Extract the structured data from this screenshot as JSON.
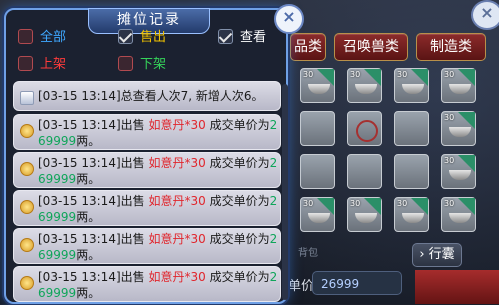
{
  "popup": {
    "title": "摊位记录",
    "filters": [
      {
        "label": "全部",
        "checked": false,
        "color": "#3fa8ff"
      },
      {
        "label": "售出",
        "checked": true,
        "color": "#f2c200"
      },
      {
        "label": "查看",
        "checked": true,
        "color": "#ffffff"
      },
      {
        "label": "上架",
        "checked": false,
        "color": "#ff3b3b"
      },
      {
        "label": "下架",
        "checked": false,
        "color": "#35d35a"
      }
    ],
    "summary": {
      "prefix": "[03-15 13:14]",
      "text": "总查看人次7, 新增人次6。"
    },
    "entries": [
      {
        "time": "[03-15 13:14]",
        "action": "出售 ",
        "item": "如意丹*30",
        "mid": " 成交单价为",
        "price_a": "2",
        "price_b": "69999",
        "unit": "两。"
      },
      {
        "time": "[03-15 13:14]",
        "action": "出售 ",
        "item": "如意丹*30",
        "mid": " 成交单价为",
        "price_a": "2",
        "price_b": "69999",
        "unit": "两。"
      },
      {
        "time": "[03-15 13:14]",
        "action": "出售 ",
        "item": "如意丹*30",
        "mid": " 成交单价为",
        "price_a": "2",
        "price_b": "69999",
        "unit": "两。"
      },
      {
        "time": "[03-15 13:14]",
        "action": "出售 ",
        "item": "如意丹*30",
        "mid": " 成交单价为",
        "price_a": "2",
        "price_b": "69999",
        "unit": "两。"
      },
      {
        "time": "[03-15 13:14]",
        "action": "出售 ",
        "item": "如意丹*30",
        "mid": " 成交单价为",
        "price_a": "2",
        "price_b": "69999",
        "unit": "两。"
      }
    ]
  },
  "right": {
    "tabs": [
      "品类",
      "召唤兽类",
      "制造类"
    ],
    "bag_label": "背包",
    "bag_button": "行囊",
    "price_label": "单价",
    "price_value": "26999",
    "badge_text": "30"
  }
}
